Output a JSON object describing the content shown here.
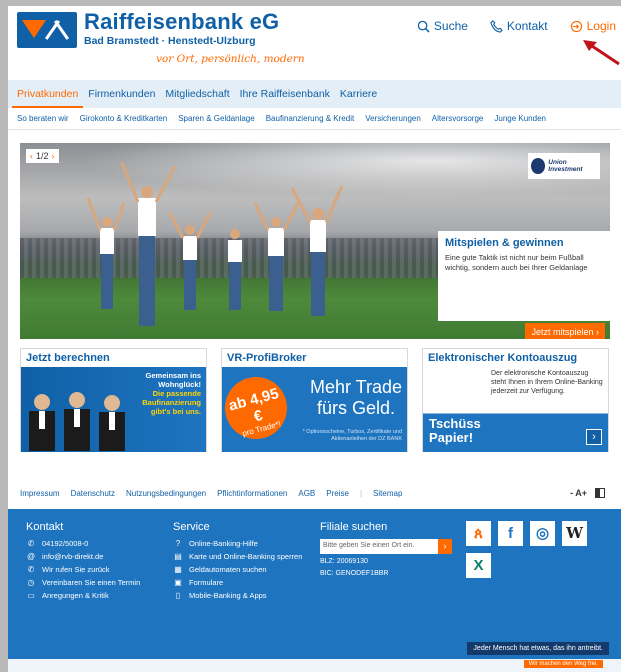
{
  "header": {
    "bank_name": "Raiffeisenbank eG",
    "subtitle": "Bad Bramstedt · Henstedt-Ulzburg",
    "slogan": "vor Ort, persönlich, modern",
    "search_label": "Suche",
    "contact_label": "Kontakt",
    "login_label": "Login"
  },
  "mainnav": {
    "tabs": [
      "Privatkunden",
      "Firmenkunden",
      "Mitgliedschaft",
      "Ihre Raiffeisenbank",
      "Karriere"
    ]
  },
  "subnav": {
    "items": [
      "So beraten wir",
      "Girokonto & Kreditkarten",
      "Sparen & Geldanlage",
      "Baufinanzierung & Kredit",
      "Versicherungen",
      "Altersvorsorge",
      "Junge Kunden"
    ]
  },
  "hero": {
    "pager": "1/2",
    "partner": "Union Investment",
    "promo_title": "Mitspielen & gewinnen",
    "promo_text": "Eine gute Taktik ist nicht nur beim Fußball wichtig, sondern auch bei Ihrer Geldanlage",
    "promo_button": "Jetzt mitspielen"
  },
  "tiles": [
    {
      "title": "Jetzt berechnen",
      "line1": "Gemeinsam ins",
      "line2": "Wohnglück!",
      "line3": "Die passende",
      "line4": "Baufinanzierung",
      "line5": "gibt's bei uns."
    },
    {
      "title": "VR-ProfiBroker",
      "badge_top": "ab 4,95 €",
      "badge_bottom": "pro Trade*!",
      "big1": "Mehr Trade",
      "big2": "fürs Geld.",
      "fine": "* Optionsscheine, Turbos, Zertifikate und Aktienanleihen der DZ BANK"
    },
    {
      "title": "Elektronischer Kontoauszug",
      "desc": "Der elektronische Kontoauszug steht Ihnen in Ihrem Online-Banking jederzeit zur Verfügung.",
      "big1": "Tschüss",
      "big2": "Papier!"
    }
  ],
  "footer_links": [
    "Impressum",
    "Datenschutz",
    "Nutzungsbedingungen",
    "Pflichtinformationen",
    "AGB",
    "Preise",
    "Sitemap"
  ],
  "font_size_control": "- A+",
  "footer": {
    "contact_title": "Kontakt",
    "contact_items": [
      "04192/5008-0",
      "info@rvb-direkt.de",
      "Wir rufen Sie zurück",
      "Vereinbaren Sie einen Termin",
      "Anregungen & Kritik"
    ],
    "service_title": "Service",
    "service_items": [
      "Online-Banking-Hilfe",
      "Karte und Online-Banking sperren",
      "Geldautomaten suchen",
      "Formulare",
      "Mobile-Banking & Apps"
    ],
    "branch_title": "Filiale suchen",
    "branch_placeholder": "Bitte geben Sie einen Ort ein.",
    "blz": "BLZ: 20069130",
    "bic": "BIC: GENODEF1BBR",
    "tagline": "Jeder Mensch hat etwas, das ihn antreibt.",
    "bottom_tag": "Wir machen den Weg frei."
  },
  "colors": {
    "brand_blue": "#0f60a6",
    "accent_orange": "#ff6a00",
    "footer_blue": "#1f74c0"
  }
}
